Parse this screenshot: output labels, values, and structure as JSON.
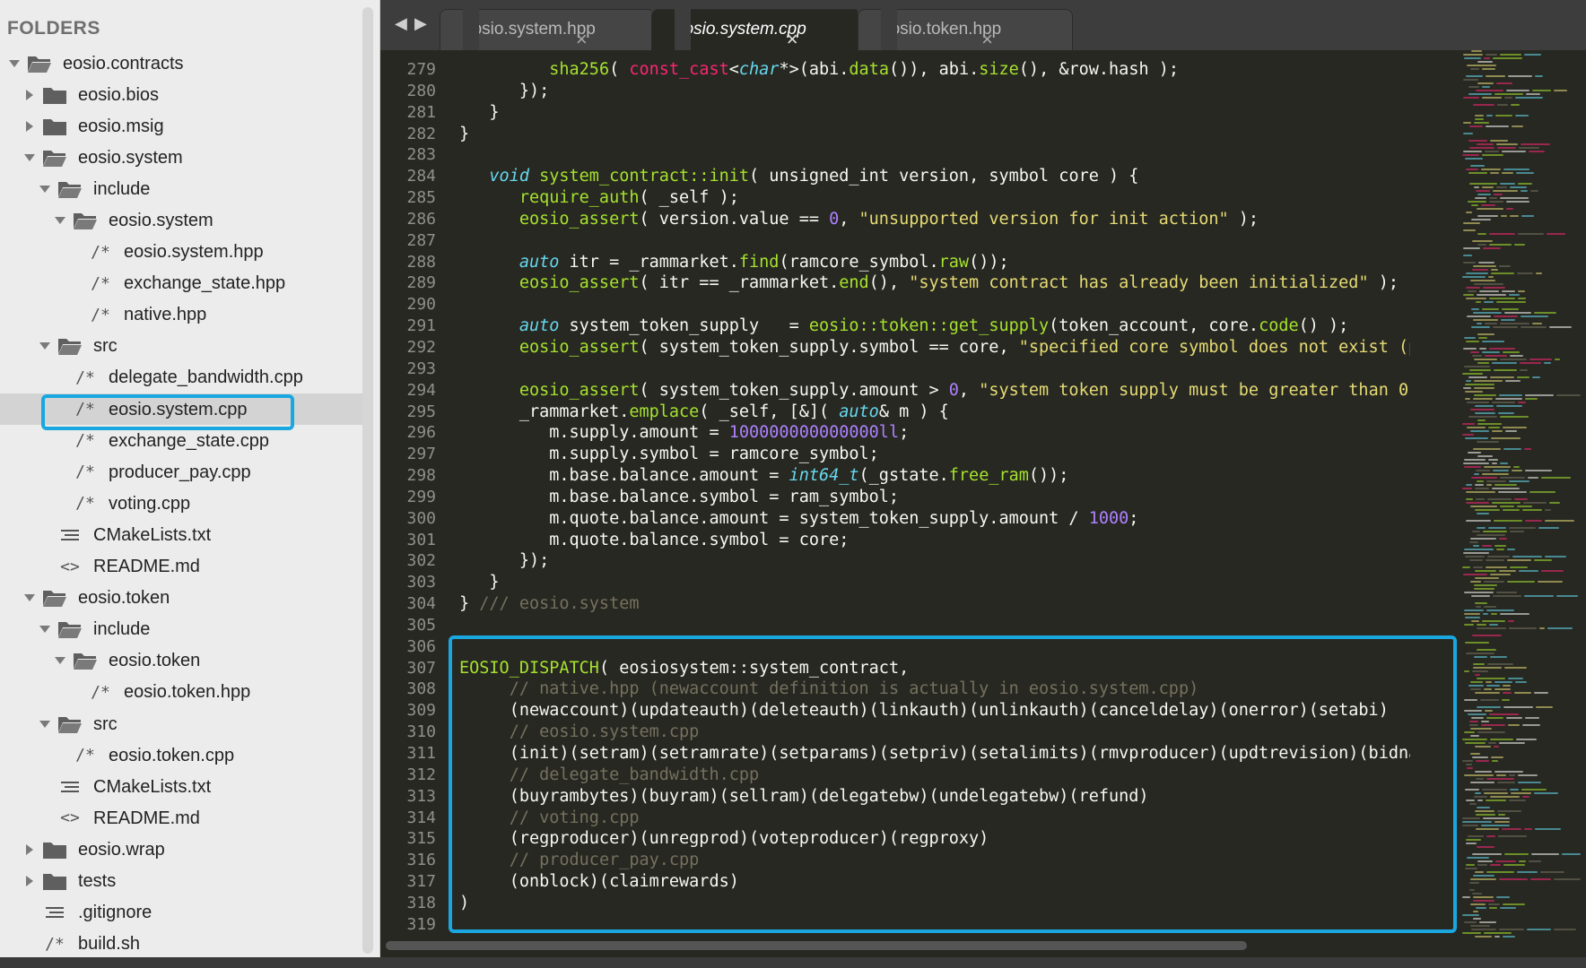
{
  "sidebar": {
    "header": "FOLDERS",
    "items": [
      {
        "label": "eosio.contracts",
        "depth": 0,
        "kind": "folder-open",
        "arrow": "down"
      },
      {
        "label": "eosio.bios",
        "depth": 1,
        "kind": "folder",
        "arrow": "right"
      },
      {
        "label": "eosio.msig",
        "depth": 1,
        "kind": "folder",
        "arrow": "right"
      },
      {
        "label": "eosio.system",
        "depth": 1,
        "kind": "folder-open",
        "arrow": "down"
      },
      {
        "label": "include",
        "depth": 2,
        "kind": "folder-open",
        "arrow": "down"
      },
      {
        "label": "eosio.system",
        "depth": 3,
        "kind": "folder-open",
        "arrow": "down"
      },
      {
        "label": "eosio.system.hpp",
        "depth": 4,
        "kind": "code-file",
        "arrow": "none"
      },
      {
        "label": "exchange_state.hpp",
        "depth": 4,
        "kind": "code-file",
        "arrow": "none"
      },
      {
        "label": "native.hpp",
        "depth": 4,
        "kind": "code-file",
        "arrow": "none"
      },
      {
        "label": "src",
        "depth": 2,
        "kind": "folder-open",
        "arrow": "down"
      },
      {
        "label": "delegate_bandwidth.cpp",
        "depth": 3,
        "kind": "code-file",
        "arrow": "none"
      },
      {
        "label": "eosio.system.cpp",
        "depth": 3,
        "kind": "code-file",
        "arrow": "none",
        "selected": true
      },
      {
        "label": "exchange_state.cpp",
        "depth": 3,
        "kind": "code-file",
        "arrow": "none"
      },
      {
        "label": "producer_pay.cpp",
        "depth": 3,
        "kind": "code-file",
        "arrow": "none"
      },
      {
        "label": "voting.cpp",
        "depth": 3,
        "kind": "code-file",
        "arrow": "none"
      },
      {
        "label": "CMakeLists.txt",
        "depth": 2,
        "kind": "text-file",
        "arrow": "none"
      },
      {
        "label": "README.md",
        "depth": 2,
        "kind": "markup-file",
        "arrow": "none"
      },
      {
        "label": "eosio.token",
        "depth": 1,
        "kind": "folder-open",
        "arrow": "down"
      },
      {
        "label": "include",
        "depth": 2,
        "kind": "folder-open",
        "arrow": "down"
      },
      {
        "label": "eosio.token",
        "depth": 3,
        "kind": "folder-open",
        "arrow": "down"
      },
      {
        "label": "eosio.token.hpp",
        "depth": 4,
        "kind": "code-file",
        "arrow": "none"
      },
      {
        "label": "src",
        "depth": 2,
        "kind": "folder-open",
        "arrow": "down"
      },
      {
        "label": "eosio.token.cpp",
        "depth": 3,
        "kind": "code-file",
        "arrow": "none"
      },
      {
        "label": "CMakeLists.txt",
        "depth": 2,
        "kind": "text-file",
        "arrow": "none"
      },
      {
        "label": "README.md",
        "depth": 2,
        "kind": "markup-file",
        "arrow": "none"
      },
      {
        "label": "eosio.wrap",
        "depth": 1,
        "kind": "folder",
        "arrow": "right"
      },
      {
        "label": "tests",
        "depth": 1,
        "kind": "folder",
        "arrow": "right"
      },
      {
        "label": ".gitignore",
        "depth": 1,
        "kind": "text-file",
        "arrow": "none"
      },
      {
        "label": "build.sh",
        "depth": 1,
        "kind": "code-file",
        "arrow": "none"
      }
    ]
  },
  "tabs": [
    {
      "label": "eosio.system.hpp",
      "active": false
    },
    {
      "label": "eosio.system.cpp",
      "active": true
    },
    {
      "label": "eosio.token.hpp",
      "active": false
    }
  ],
  "icons": {
    "nav_back": "◀",
    "nav_forward": "▶",
    "tab_close": "×"
  },
  "colors": {
    "highlight": "#1aa7e0",
    "editor_bg": "#272822",
    "sidebar_bg": "#ececec"
  },
  "editor": {
    "lines": [
      {
        "n": "279",
        "t": [
          [
            "",
            "         "
          ],
          [
            "fn",
            "sha256"
          ],
          [
            "",
            "( "
          ],
          [
            "pk",
            "const_cast"
          ],
          [
            "",
            "<"
          ],
          [
            "ty",
            "char"
          ],
          [
            "",
            "*>(abi."
          ],
          [
            "fn",
            "data"
          ],
          [
            "",
            "()), abi."
          ],
          [
            "fn",
            "size"
          ],
          [
            "",
            "(), &row.hash );"
          ]
        ]
      },
      {
        "n": "280",
        "t": [
          [
            "",
            "      });"
          ]
        ]
      },
      {
        "n": "281",
        "t": [
          [
            "",
            "   }"
          ]
        ]
      },
      {
        "n": "282",
        "t": [
          [
            "",
            "}"
          ]
        ]
      },
      {
        "n": "283",
        "t": [
          [
            "",
            ""
          ]
        ]
      },
      {
        "n": "284",
        "t": [
          [
            "",
            "   "
          ],
          [
            "kw",
            "void"
          ],
          [
            "",
            ""
          ],
          [
            "fn",
            " system_contract::init"
          ],
          [
            "",
            "( unsigned_int version, symbol core ) {"
          ]
        ]
      },
      {
        "n": "285",
        "t": [
          [
            "",
            "      "
          ],
          [
            "fn",
            "require_auth"
          ],
          [
            "",
            "( _self );"
          ]
        ]
      },
      {
        "n": "286",
        "t": [
          [
            "",
            "      "
          ],
          [
            "fn",
            "eosio_assert"
          ],
          [
            "",
            "( version.value == "
          ],
          [
            "nu",
            "0"
          ],
          [
            "",
            ", "
          ],
          [
            "st",
            "\"unsupported version for init action\""
          ],
          [
            "",
            " );"
          ]
        ]
      },
      {
        "n": "287",
        "t": [
          [
            "",
            ""
          ]
        ]
      },
      {
        "n": "288",
        "t": [
          [
            "",
            "      "
          ],
          [
            "kw",
            "auto"
          ],
          [
            "",
            " itr = _rammarket."
          ],
          [
            "fn",
            "find"
          ],
          [
            "",
            "(ramcore_symbol."
          ],
          [
            "fn",
            "raw"
          ],
          [
            "",
            "());"
          ]
        ]
      },
      {
        "n": "289",
        "t": [
          [
            "",
            "      "
          ],
          [
            "fn",
            "eosio_assert"
          ],
          [
            "",
            "( itr == _rammarket."
          ],
          [
            "fn",
            "end"
          ],
          [
            "",
            "(), "
          ],
          [
            "st",
            "\"system contract has already been initialized\""
          ],
          [
            "",
            " );"
          ]
        ]
      },
      {
        "n": "290",
        "t": [
          [
            "",
            ""
          ]
        ]
      },
      {
        "n": "291",
        "t": [
          [
            "",
            "      "
          ],
          [
            "kw",
            "auto"
          ],
          [
            "",
            " system_token_supply   = "
          ],
          [
            "fn",
            "eosio::token::get_supply"
          ],
          [
            "",
            "(token_account, core."
          ],
          [
            "fn",
            "code"
          ],
          [
            "",
            "() );"
          ]
        ]
      },
      {
        "n": "292",
        "t": [
          [
            "",
            "      "
          ],
          [
            "fn",
            "eosio_assert"
          ],
          [
            "",
            "( system_token_supply.symbol == core, "
          ],
          [
            "st",
            "\"specified core symbol does not exist (precis"
          ]
        ]
      },
      {
        "n": "293",
        "t": [
          [
            "",
            ""
          ]
        ]
      },
      {
        "n": "294",
        "t": [
          [
            "",
            "      "
          ],
          [
            "fn",
            "eosio_assert"
          ],
          [
            "",
            "( system_token_supply.amount > "
          ],
          [
            "nu",
            "0"
          ],
          [
            "",
            ", "
          ],
          [
            "st",
            "\"system token supply must be greater than 0\""
          ],
          [
            "",
            " );"
          ]
        ]
      },
      {
        "n": "295",
        "t": [
          [
            "",
            "      _rammarket."
          ],
          [
            "fn",
            "emplace"
          ],
          [
            "",
            "( _self, [&]( "
          ],
          [
            "kw",
            "auto"
          ],
          [
            "",
            "& m ) {"
          ]
        ]
      },
      {
        "n": "296",
        "t": [
          [
            "",
            "         m.supply.amount = "
          ],
          [
            "nu",
            "100000000000000ll"
          ],
          [
            "",
            ";"
          ]
        ]
      },
      {
        "n": "297",
        "t": [
          [
            "",
            "         m.supply.symbol = ramcore_symbol;"
          ]
        ]
      },
      {
        "n": "298",
        "t": [
          [
            "",
            "         m.base.balance.amount = "
          ],
          [
            "ty",
            "int64_t"
          ],
          [
            "",
            "(_gstate."
          ],
          [
            "fn",
            "free_ram"
          ],
          [
            "",
            "());"
          ]
        ]
      },
      {
        "n": "299",
        "t": [
          [
            "",
            "         m.base.balance.symbol = ram_symbol;"
          ]
        ]
      },
      {
        "n": "300",
        "t": [
          [
            "",
            "         m.quote.balance.amount = system_token_supply.amount / "
          ],
          [
            "nu",
            "1000"
          ],
          [
            "",
            ";"
          ]
        ]
      },
      {
        "n": "301",
        "t": [
          [
            "",
            "         m.quote.balance.symbol = core;"
          ]
        ]
      },
      {
        "n": "302",
        "t": [
          [
            "",
            "      });"
          ]
        ]
      },
      {
        "n": "303",
        "t": [
          [
            "",
            "   }"
          ]
        ]
      },
      {
        "n": "304",
        "t": [
          [
            "",
            "} "
          ],
          [
            "cm",
            "/// eosio.system"
          ]
        ]
      },
      {
        "n": "305",
        "t": [
          [
            "",
            ""
          ]
        ]
      },
      {
        "n": "306",
        "t": [
          [
            "",
            ""
          ]
        ]
      },
      {
        "n": "307",
        "t": [
          [
            "fn",
            "EOSIO_DISPATCH"
          ],
          [
            "",
            "( eosiosystem::system_contract,"
          ]
        ]
      },
      {
        "n": "308",
        "t": [
          [
            "",
            "     "
          ],
          [
            "cm",
            "// native.hpp (newaccount definition is actually in eosio.system.cpp)"
          ]
        ]
      },
      {
        "n": "309",
        "t": [
          [
            "",
            "     (newaccount)(updateauth)(deleteauth)(linkauth)(unlinkauth)(canceldelay)(onerror)(setabi)"
          ]
        ]
      },
      {
        "n": "310",
        "t": [
          [
            "",
            "     "
          ],
          [
            "cm",
            "// eosio.system.cpp"
          ]
        ]
      },
      {
        "n": "311",
        "t": [
          [
            "",
            "     (init)(setram)(setramrate)(setparams)(setpriv)(setalimits)(rmvproducer)(updtrevision)(bidname)(b"
          ]
        ]
      },
      {
        "n": "312",
        "t": [
          [
            "",
            "     "
          ],
          [
            "cm",
            "// delegate_bandwidth.cpp"
          ]
        ]
      },
      {
        "n": "313",
        "t": [
          [
            "",
            "     (buyrambytes)(buyram)(sellram)(delegatebw)(undelegatebw)(refund)"
          ]
        ]
      },
      {
        "n": "314",
        "t": [
          [
            "",
            "     "
          ],
          [
            "cm",
            "// voting.cpp"
          ]
        ]
      },
      {
        "n": "315",
        "t": [
          [
            "",
            "     (regproducer)(unregprod)(voteproducer)(regproxy)"
          ]
        ]
      },
      {
        "n": "316",
        "t": [
          [
            "",
            "     "
          ],
          [
            "cm",
            "// producer_pay.cpp"
          ]
        ]
      },
      {
        "n": "317",
        "t": [
          [
            "",
            "     (onblock)(claimrewards)"
          ]
        ]
      },
      {
        "n": "318",
        "t": [
          [
            "",
            ")"
          ]
        ]
      },
      {
        "n": "319",
        "t": [
          [
            "",
            ""
          ]
        ]
      }
    ]
  }
}
